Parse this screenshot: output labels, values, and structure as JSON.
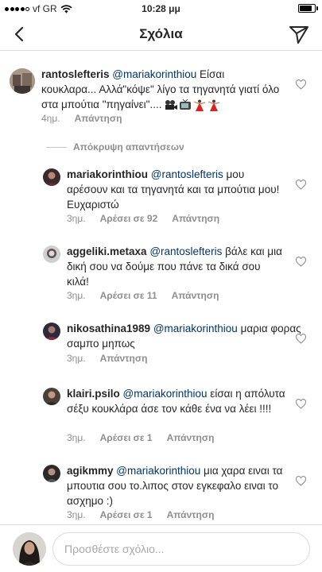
{
  "status_bar": {
    "carrier": "vf GR",
    "time": "10:28 μμ",
    "signal_bars": 4,
    "battery_level": 0.85
  },
  "nav": {
    "title": "Σχόλια"
  },
  "main_comment": {
    "username": "rantoslefteris",
    "mention": "@mariakorinthiou",
    "text": " Είσαι κουκλαρα... Αλλά\"κόψε\" λίγο τα τηγανητά γιατί όλο στα μπούτια \"πηγαίνει\"....",
    "time": "4ημ.",
    "reply_label": "Απάντηση"
  },
  "hide_replies_label": "Απόκρυψη απαντήσεων",
  "replies": [
    {
      "username": "mariakorinthiou",
      "mention": "@rantoslefteris",
      "text": " μου αρέσουν και τα τηγανητά και τα μπούτια μου! Ευχαριστώ",
      "time": "3ημ.",
      "likes": "Αρέσει σε 92",
      "reply_label": "Απάντηση"
    },
    {
      "username": "aggeliki.metaxa",
      "mention": "@rantoslefteris",
      "text": " βάλε και μια δική σου να δούμε που πάνε τα δικά σου κιλά!",
      "time": "3ημ.",
      "likes": "Αρέσει σε 11",
      "reply_label": "Απάντηση"
    },
    {
      "username": "nikosathina1989",
      "mention": "@mariakorinthiou",
      "text": "  μαρια φορας σαμπο μηπως",
      "time": "3ημ.",
      "likes": "",
      "reply_label": "Απάντηση"
    },
    {
      "username": "klairi.psilo",
      "mention": "@mariakorinthiou",
      "text": " είσαι η απόλυτα σέξυ κουκλάρα άσε τον κάθε ένα να λέει !!!!",
      "time": "3ημ.",
      "likes": "Αρέσει σε 1",
      "reply_label": "Απάντηση"
    },
    {
      "username": "agikmmy",
      "mention": "@mariakorinthiou",
      "text": " μια χαρα ειναι τα μπουτια σου το.λιπος στον εγκεφαλο ειναι το ασχημο :)",
      "time": "3ημ.",
      "likes": "Αρέσει σε 1",
      "reply_label": "Απάντηση"
    }
  ],
  "composer": {
    "placeholder": "Προσθέστε σχόλιο..."
  },
  "colors": {
    "text": "#262626",
    "mention": "#003569",
    "muted": "#8e8e8e",
    "divider": "#dbdbdb"
  }
}
